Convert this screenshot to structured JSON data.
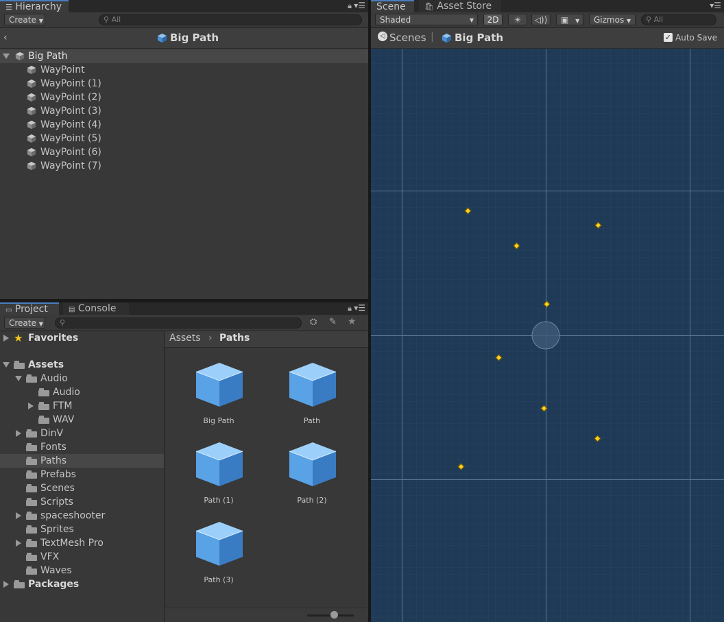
{
  "hierarchy": {
    "tab_label": "Hierarchy",
    "create_label": "Create",
    "search_placeholder": "All",
    "breadcrumb_title": "Big Path",
    "root": "Big Path",
    "children": [
      "WayPoint",
      "WayPoint (1)",
      "WayPoint (2)",
      "WayPoint (3)",
      "WayPoint (4)",
      "WayPoint (5)",
      "WayPoint (6)",
      "WayPoint (7)"
    ]
  },
  "scene": {
    "tabs": [
      "Scene",
      "Asset Store"
    ],
    "shading_mode": "Shaded",
    "mode_2d": "2D",
    "gizmos_label": "Gizmos",
    "search_placeholder": "All",
    "breadcrumb_root": "Scenes",
    "breadcrumb_current": "Big Path",
    "auto_save_label": "Auto Save",
    "auto_save_checked": true
  },
  "project": {
    "tabs": [
      "Project",
      "Console"
    ],
    "create_label": "Create",
    "tree": [
      {
        "label": "Favorites",
        "bold": true
      },
      {
        "label": "Assets",
        "bold": true
      },
      {
        "label": "Audio"
      },
      {
        "label": "Audio"
      },
      {
        "label": "FTM"
      },
      {
        "label": "WAV"
      },
      {
        "label": "DinV"
      },
      {
        "label": "Fonts"
      },
      {
        "label": "Paths",
        "selected": true
      },
      {
        "label": "Prefabs"
      },
      {
        "label": "Scenes"
      },
      {
        "label": "Scripts"
      },
      {
        "label": "spaceshooter"
      },
      {
        "label": "Sprites"
      },
      {
        "label": "TextMesh Pro"
      },
      {
        "label": "VFX"
      },
      {
        "label": "Waves"
      },
      {
        "label": "Packages",
        "bold": true
      }
    ],
    "breadcrumb": [
      "Assets",
      "Paths"
    ],
    "assets": [
      "Big Path",
      "Path",
      "Path (1)",
      "Path (2)",
      "Path (3)"
    ]
  },
  "colors": {
    "accent": "#4a7fbf",
    "scene_bg": "#1f3a56",
    "waypoint": "#ffd21f"
  }
}
